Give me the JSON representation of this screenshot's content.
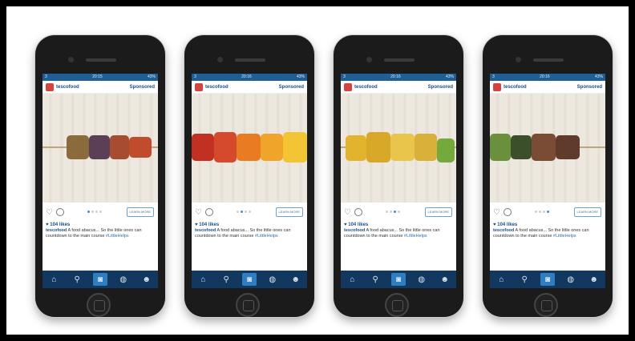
{
  "account": "tescofood",
  "sponsored": "Sponsored",
  "status": {
    "carrier": "3",
    "time_a": "20:15",
    "time_b": "20:16",
    "battery": "43%"
  },
  "likes": "104 likes",
  "caption_user": "tescofood",
  "caption_text": "A food abacus... So the little ones can countdown to the main course",
  "hashtag": "#LittleHelps",
  "cta": "LEARN MORE",
  "phones": [
    {
      "time": "20:15",
      "active_dot": 0,
      "veg": [
        "#8b6b3c",
        "#5b3f56",
        "#a74b31",
        "#c04b2d"
      ]
    },
    {
      "time": "20:16",
      "active_dot": 1,
      "veg": [
        "#c23021",
        "#d44a2a",
        "#e97c22",
        "#f0a52a",
        "#f3c433"
      ]
    },
    {
      "time": "20:16",
      "active_dot": 2,
      "veg": [
        "#e2b32c",
        "#d8a829",
        "#e9c54b",
        "#d9b03a",
        "#76a93c"
      ]
    },
    {
      "time": "20:16",
      "active_dot": 3,
      "veg": [
        "#6a8f3d",
        "#3b4f2b",
        "#7a4c35",
        "#5e3b2a"
      ]
    }
  ],
  "tabbar": {
    "home": "home-icon",
    "search": "search-icon",
    "camera": "camera-icon",
    "activity": "activity-icon",
    "profile": "profile-icon"
  },
  "colors": {
    "status": "#1f5f95",
    "tabbar": "#12385f",
    "accent": "#2f7fc0",
    "name": "#1b4f87"
  }
}
